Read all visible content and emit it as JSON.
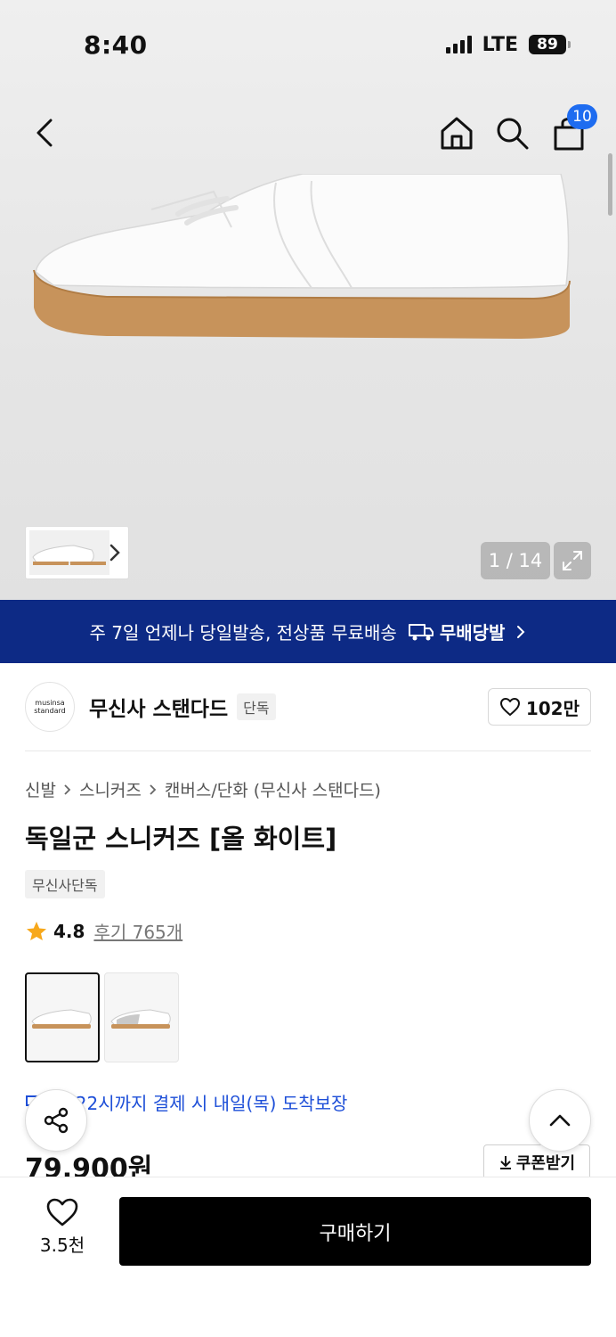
{
  "status_bar": {
    "time": "8:40",
    "network": "LTE",
    "battery": "89"
  },
  "header": {
    "cart_count": "10"
  },
  "gallery": {
    "counter": "1 / 14"
  },
  "banner": {
    "text": "주 7일 언제나 당일발송, 전상품 무료배송",
    "brand": "무배당발"
  },
  "brand": {
    "logo_line1": "musinsa",
    "logo_line2": "standard",
    "name": "무신사 스탠다드",
    "tag": "단독",
    "likes": "102만"
  },
  "breadcrumb": [
    "신발",
    "스니커즈",
    "캔버스/단화 (무신사 스탠다드)"
  ],
  "product": {
    "title": "독일군 스니커즈 [올 화이트]",
    "exclusive_tag": "무신사단독",
    "rating": "4.8",
    "reviews": "후기 765개",
    "delivery": "늘 22시까지 결제 시 내일(목) 도착보장",
    "price": "79,900원",
    "coupon_label": "쿠폰받기"
  },
  "bottom_bar": {
    "wish_count": "3.5천",
    "buy_label": "구매하기"
  },
  "colors": {
    "accent_blue": "#1e6cf0",
    "banner_navy": "#0d2a85",
    "star": "#f7a81b",
    "buy_button": "#000000"
  }
}
